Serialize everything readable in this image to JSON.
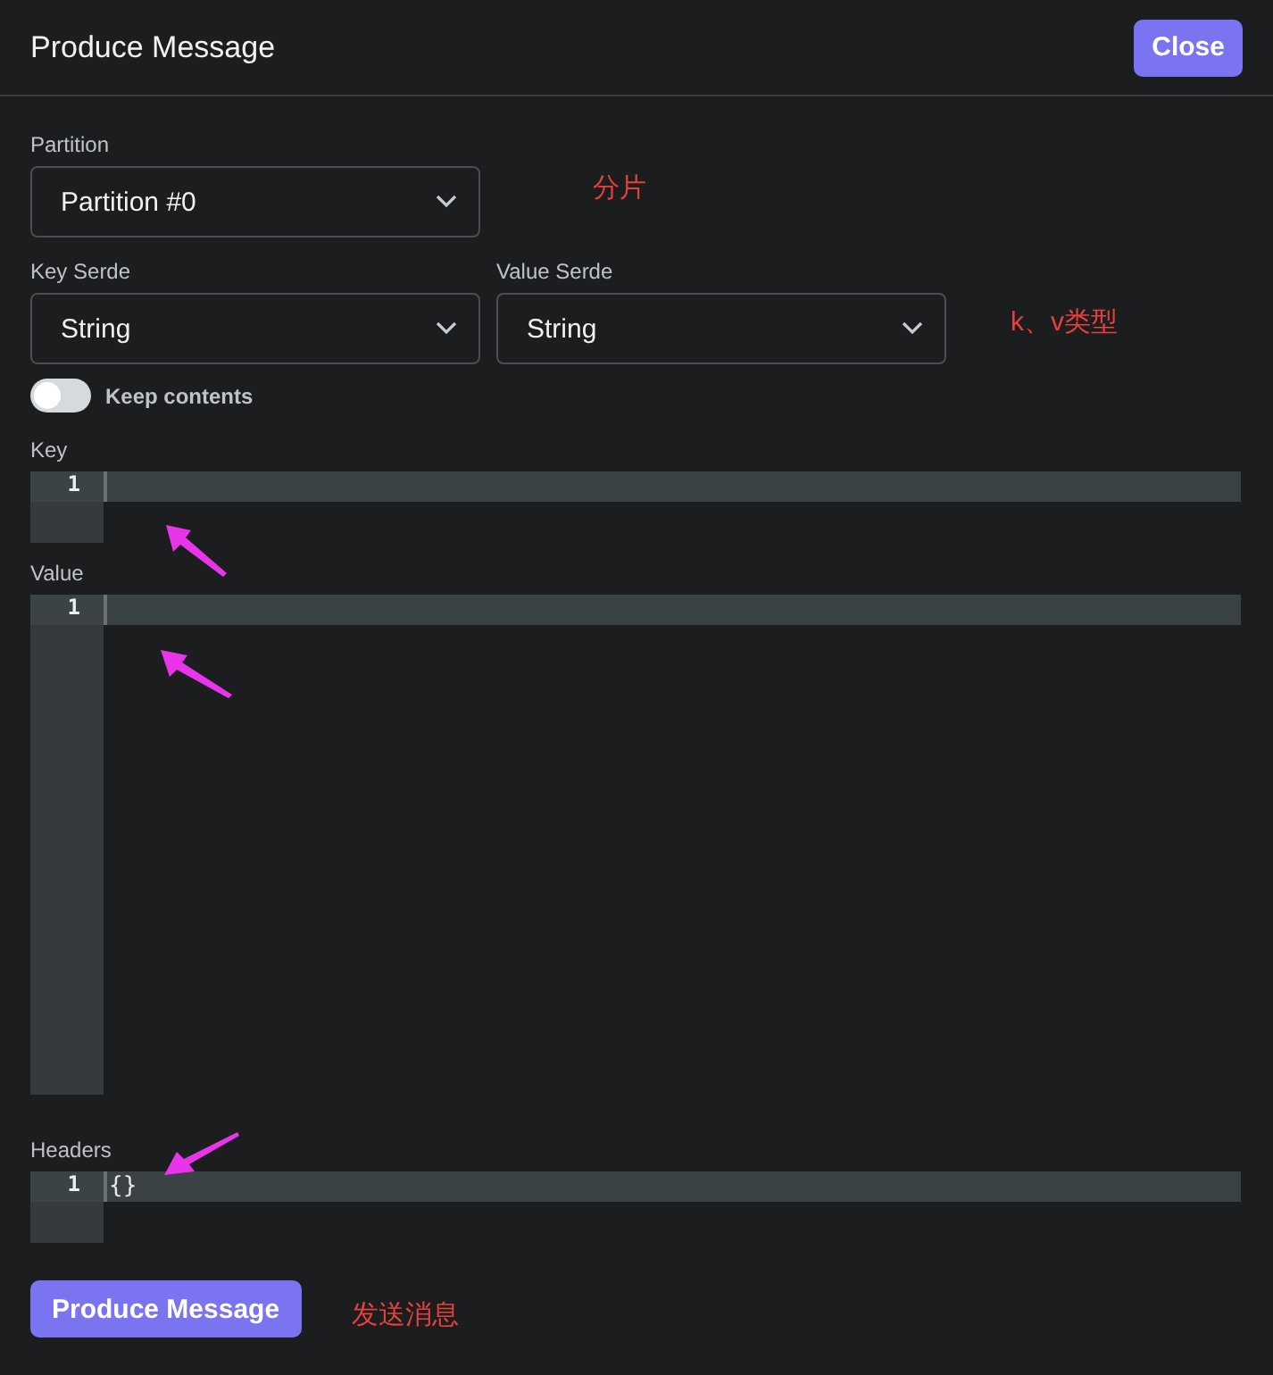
{
  "dialog": {
    "title": "Produce Message",
    "close_button": "Close"
  },
  "partition": {
    "label": "Partition",
    "value": "Partition #0"
  },
  "key_serde": {
    "label": "Key Serde",
    "value": "String"
  },
  "value_serde": {
    "label": "Value Serde",
    "value": "String"
  },
  "keep_contents": {
    "label": "Keep contents",
    "on": false
  },
  "editors": [
    {
      "label": "Key",
      "line_number": "1"
    },
    {
      "label": "Value",
      "line_number": "1"
    },
    {
      "label": "Headers",
      "line_number": "1",
      "content": "{}"
    }
  ],
  "submit_button": "Produce Message",
  "annotations": [
    {
      "text": "分片"
    },
    {
      "text": "k、v类型"
    },
    {
      "text": "发送消息"
    }
  ]
}
